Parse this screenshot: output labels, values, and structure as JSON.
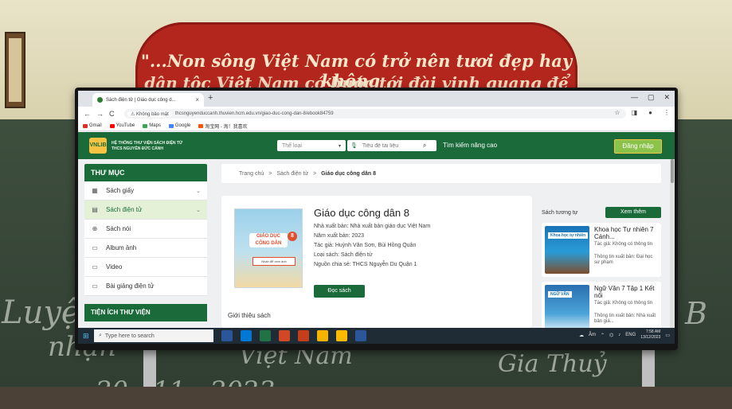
{
  "scene": {
    "banner_line1": "\"...Non sông Việt Nam có trở nên tươi đẹp hay không ,",
    "banner_line2": "dân tộc Việt Nam có bước tới đài vinh quang để sánh vai",
    "chalk": [
      "Luyệ",
      "nhận",
      "20 - 11 - 2023",
      "Việt Nam",
      "Gia Thuỷ",
      "B"
    ]
  },
  "browser": {
    "tab_title": "Sách điện tử | Giáo dục công d...",
    "new_tab": "+",
    "window_controls": [
      "—",
      "▢",
      "✕"
    ],
    "nav": [
      "←",
      "→",
      "C"
    ],
    "insecure_label": "Không bảo mật",
    "url": "thcsnguyenduccanh.thuvien.hcm.edu.vn/giao-duc-cong-dan-8/ebook84759",
    "nav_right": [
      "☆",
      "◨",
      "●",
      "⋮"
    ],
    "bookmarks": [
      {
        "label": "Gmail",
        "color": "#d93025"
      },
      {
        "label": "YouTube",
        "color": "#ff0000"
      },
      {
        "label": "Maps",
        "color": "#34a853"
      },
      {
        "label": "Google",
        "color": "#4285f4"
      },
      {
        "label": "淘宝网 - 淘！我喜欢",
        "color": "#ff5000"
      }
    ]
  },
  "site": {
    "logo_text": "VNLIB",
    "org_line1": "HỆ THỐNG THƯ VIỆN SÁCH ĐIỆN TỬ",
    "org_line2": "THCS NGUYỄN ĐỨC CẢNH",
    "category_placeholder": "Thể loại",
    "search_placeholder": "Tiêu đề tài liệu",
    "advanced_search": "Tìm kiếm nâng cao",
    "login": "Đăng nhập"
  },
  "sidebar": {
    "title": "THƯ MỤC",
    "items": [
      {
        "label": "Sách giấy",
        "icon": "▦",
        "chevron": "⌄"
      },
      {
        "label": "Sách điện tử",
        "icon": "▤",
        "chevron": "⌄"
      },
      {
        "label": "Sách nói",
        "icon": "⊕",
        "chevron": ""
      },
      {
        "label": "Album ảnh",
        "icon": "▭",
        "chevron": ""
      },
      {
        "label": "Video",
        "icon": "▭",
        "chevron": ""
      },
      {
        "label": "Bài giảng điện tử",
        "icon": "▭",
        "chevron": ""
      }
    ],
    "utilities_title": "TIỆN ÍCH THƯ VIỆN"
  },
  "breadcrumb": {
    "home": "Trang chủ",
    "sep": ">",
    "section": "Sách điện tử",
    "current": "Giáo dục công dân 8"
  },
  "book": {
    "cover_title": "GIÁO DỤC CÔNG DÂN",
    "cover_number": "8",
    "cover_sticker": "Nhấn để xem ảnh",
    "title": "Giáo dục công dân 8",
    "publisher": "Nhà xuất bản: Nhà xuất bản giáo dục Việt Nam",
    "year": "Năm xuất bản: 2023",
    "authors": "Tác giả: Huỳnh Văn Sơn, Bùi Hồng Quân",
    "type": "Loại sách: Sách điện tử",
    "source": "Nguồn chia sẻ: THCS Nguyễn Du Quận 1",
    "read_button": "Đọc sách",
    "intro_heading": "Giới thiệu sách"
  },
  "similar": {
    "title": "Sách tương tự",
    "see_more": "Xem thêm",
    "items": [
      {
        "cover_title": "Khoa học tự nhiên",
        "name": "Khoa học Tự nhiên 7 Cánh...",
        "author": "Tác giả: Không có thông tin",
        "publisher": "Thông tin xuất bản: Đại học sư phạm"
      },
      {
        "cover_title": "NGỮ VĂN",
        "name": "Ngữ Văn 7 Tập 1 Kết nối",
        "author": "Tác giả: Không có thông tin",
        "publisher": "Thông tin xuất bản: Nhà xuất bản giá..."
      }
    ]
  },
  "taskbar": {
    "search_placeholder": "Type here to search",
    "app_colors": [
      "#2b579a",
      "#0078d4",
      "#217346",
      "#d24726",
      "#c43e1c",
      "#f4b400",
      "#ffb900",
      "#2b579a"
    ],
    "weather": "Âm",
    "lang": "ENG",
    "time": "7:58 AM",
    "date": "13/12/2023"
  }
}
